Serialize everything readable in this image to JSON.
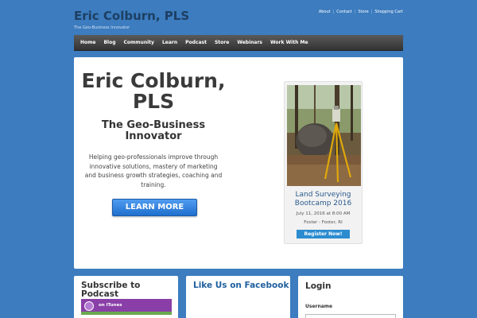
{
  "site": {
    "title": "Eric Colburn, PLS",
    "tagline": "The Geo-Business Innovator"
  },
  "top_links": [
    "About",
    "Contact",
    "Store",
    "Shopping Cart"
  ],
  "nav": [
    "Home",
    "Blog",
    "Community",
    "Learn",
    "Podcast",
    "Store",
    "Webinars",
    "Work With Me"
  ],
  "hero": {
    "title": "Eric Colburn, PLS",
    "subtitle": "The Geo-Business Innovator",
    "description": "Helping geo-professionals improve through innovative solutions, mastery of marketing and business growth strategies, coaching and training.",
    "button_label": "LEARN MORE"
  },
  "event": {
    "title": "Land Surveying Bootcamp 2016",
    "date": "July 11, 2016 at 8:00 AM",
    "location": "Foster - Foster, RI",
    "button_label": "Register Now!"
  },
  "widgets": {
    "subscribe_title": "Subscribe to Podcast",
    "itunes_label": "on iTunes",
    "facebook_title": "Like Us on Facebook",
    "login_title": "Login",
    "username_label": "Username"
  },
  "colors": {
    "background": "#3c7cbf",
    "navbar": "#3a3a3a",
    "button_blue": "#2f80dd",
    "itunes_purple": "#8a3fa8"
  }
}
